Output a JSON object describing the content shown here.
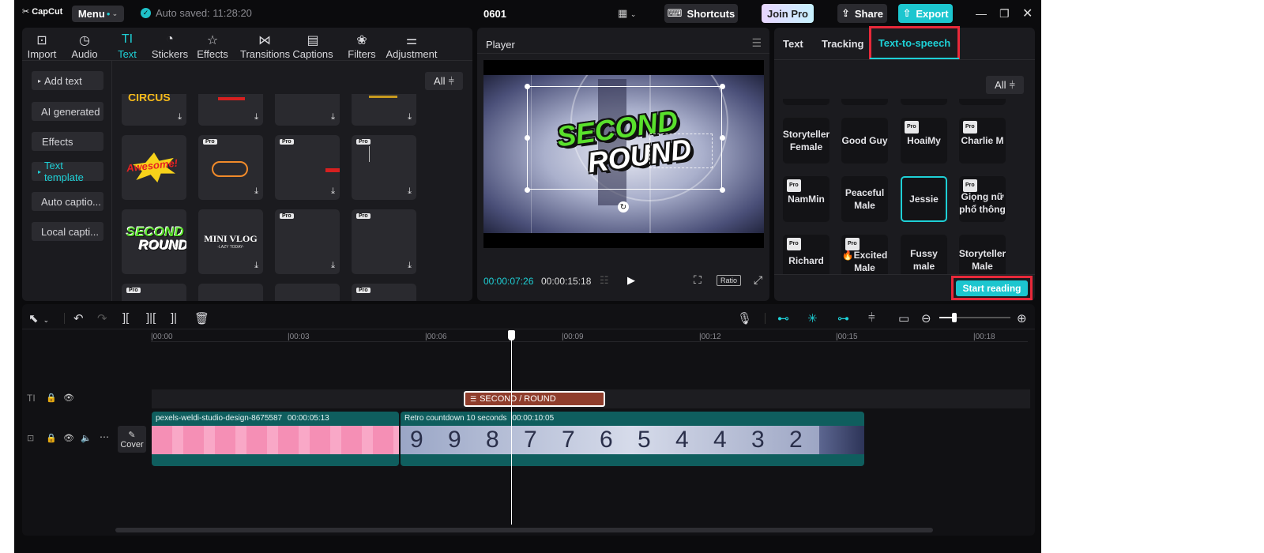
{
  "app": {
    "logo": "CapCut",
    "menu_label": "Menu",
    "autosave": "Auto saved: 11:28:20",
    "project_name": "0601",
    "shortcuts_label": "Shortcuts",
    "join_pro_label": "Join Pro",
    "share_label": "Share",
    "export_label": "Export"
  },
  "tools": [
    "Import",
    "Audio",
    "Text",
    "Stickers",
    "Effects",
    "Transitions",
    "Captions",
    "Filters",
    "Adjustment"
  ],
  "active_tool": "Text",
  "text_sidebar": [
    "Add text",
    "AI generated",
    "Effects",
    "Text template",
    "Auto captio...",
    "Local capti..."
  ],
  "filter_label": "All",
  "templates": {
    "awesome": "Awesome!",
    "second": "SECOND",
    "round": "ROUND",
    "mini_vlog": "MINI VLOG",
    "mini_vlog_sub": "-LAZY TODAY-",
    "pro_badge": "Pro"
  },
  "player": {
    "title": "Player",
    "current_time": "00:00:07:26",
    "total_time": "00:00:15:18",
    "ratio_label": "Ratio",
    "overlay_line1": "SECOND",
    "overlay_line2": "ROUND"
  },
  "right_panel": {
    "tabs": [
      "Text",
      "Tracking",
      "Text-to-speech"
    ],
    "active_tab": "Text-to-speech",
    "filter_label": "All",
    "voices": [
      {
        "name": "Storyteller Female",
        "pro": false
      },
      {
        "name": "Good Guy",
        "pro": false
      },
      {
        "name": "HoaiMy",
        "pro": true
      },
      {
        "name": "Charlie M",
        "pro": true
      },
      {
        "name": "NamMin",
        "pro": true
      },
      {
        "name": "Peaceful Male",
        "pro": false
      },
      {
        "name": "Jessie",
        "pro": false,
        "selected": true
      },
      {
        "name": "Giọng nữ phổ thông",
        "pro": true
      },
      {
        "name": "Richard",
        "pro": true
      },
      {
        "name": "🔥Excited Male",
        "pro": true
      },
      {
        "name": "Fussy male",
        "pro": false
      },
      {
        "name": "Storyteller Male",
        "pro": false
      }
    ],
    "start_button": "Start reading"
  },
  "timeline": {
    "ruler": [
      "|00:00",
      "|00:03",
      "|00:06",
      "|00:09",
      "|00:12",
      "|00:15",
      "|00:18"
    ],
    "text_clip": "SECOND / ROUND",
    "cover_label": "Cover",
    "clip1_label": "pexels-weldi-studio-design-8675587",
    "clip1_duration": "00:00:05:13",
    "clip2_label": "Retro countdown 10 seconds",
    "clip2_duration": "00:00:10:05",
    "countdown_digits": [
      "9",
      "9",
      "8",
      "7",
      "7",
      "6",
      "5",
      "4",
      "4",
      "3",
      "2"
    ]
  },
  "colors": {
    "accent": "#1ed0d6",
    "highlight_red": "#e8293a",
    "text_clip": "#8f3d2c",
    "video_track": "#0f5e5e",
    "pink_clip": "#f58fb5"
  }
}
